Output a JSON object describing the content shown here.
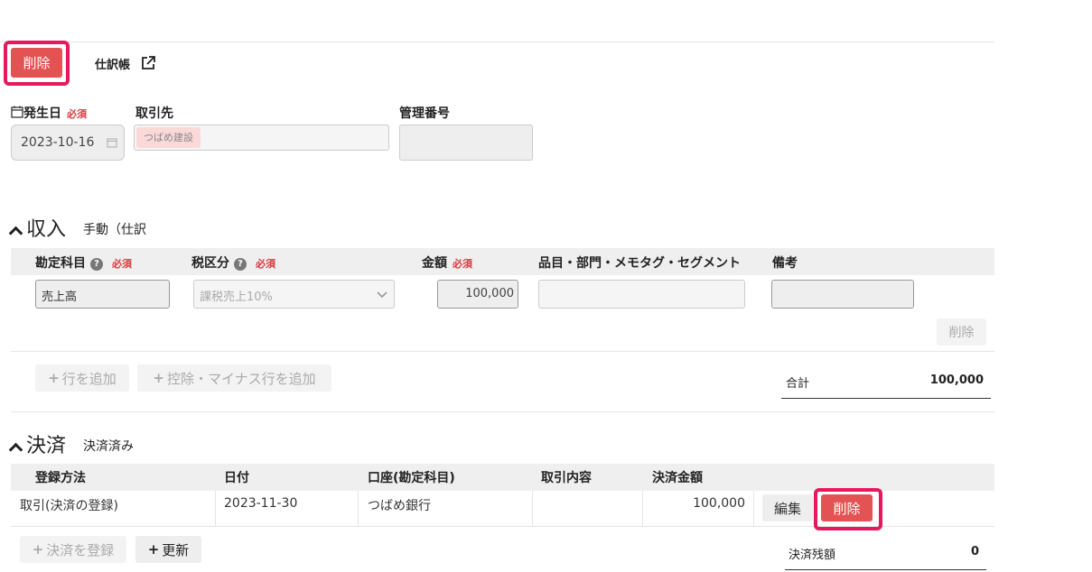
{
  "toolbar": {
    "delete_label": "削除",
    "journal_label": "仕訳帳"
  },
  "form": {
    "date": {
      "label": "発生日",
      "required": "必須",
      "value": "2023-10-16"
    },
    "partner": {
      "label": "取引先",
      "value": "つばめ建設"
    },
    "manage_no": {
      "label": "管理番号",
      "value": ""
    }
  },
  "income": {
    "title": "収入",
    "subtitle": "手動（仕訳",
    "headers": {
      "account": "勘定科目",
      "tax": "税区分",
      "amount": "金額",
      "items": "品目・部門・メモタグ・セグメント",
      "note": "備考",
      "required": "必須"
    },
    "row": {
      "account": "売上高",
      "tax": "課税売上10%",
      "amount": "100,000",
      "items": "",
      "note": "",
      "delete_label": "削除"
    },
    "add_row_label": "行を追加",
    "add_deduction_label": "控除・マイナス行を追加",
    "total_label": "合計",
    "total_value": "100,000"
  },
  "settlement": {
    "title": "決済",
    "subtitle": "決済済み",
    "headers": {
      "method": "登録方法",
      "date": "日付",
      "account": "口座(勘定科目)",
      "content": "取引内容",
      "amount": "決済金額"
    },
    "row": {
      "method": "取引(決済の登録)",
      "date": "2023-11-30",
      "account": "つばめ銀行",
      "content": "",
      "amount": "100,000",
      "edit_label": "編集",
      "delete_label": "削除"
    },
    "register_label": "決済を登録",
    "update_label": "更新",
    "balance_label": "決済残額",
    "balance_value": "0"
  },
  "colors": {
    "highlight": "#e8185d",
    "danger": "#e45353",
    "required": "#d9383c",
    "partner_tag_bg": "#fbd9d9"
  }
}
